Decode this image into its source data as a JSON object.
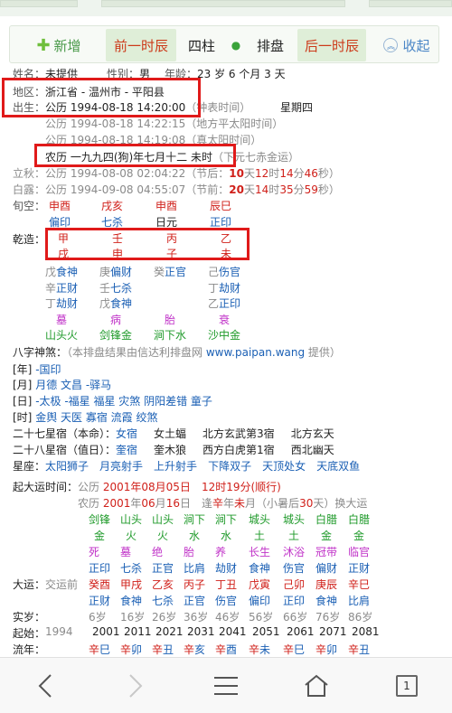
{
  "toolbar": {
    "add": "新增",
    "prev": "前一时辰",
    "sizhu": "四柱",
    "dot": "●",
    "pai": "排盘",
    "next": "后一时辰",
    "fold": "收起"
  },
  "profile": {
    "name_label": "姓名：",
    "name_value": "未提供",
    "gender_label": "性别：",
    "gender_value": "男",
    "age_label": "年龄：",
    "age_value": "23 岁 6 个月 3 天",
    "region_label": "地区：",
    "region_value": "浙江省 - 温州市 - 平阳县",
    "birth_label": "出生：",
    "birth_value": "公历 1994-08-18 14:20:00",
    "birth_note": "（钟表时间）",
    "weekday": "星期四",
    "solar_local": "公历 1994-08-18 14:22:15",
    "solar_local_note": "（地方平太阳时间）",
    "solar_true": "公历 1994-08-18 14:19:08",
    "solar_true_note": "（真太阳时间）",
    "lunar": "农历 一九九四(狗)年七月十二 未时",
    "lunar_note": "（下元七赤金运）"
  },
  "jieqi": {
    "liqiu_label": "立秋：",
    "liqiu_date": "公历 1994-08-08 02:04:22",
    "liqiu_jie": "（节后：",
    "liqiu_days": "10",
    "liqiu_days_unit": "天",
    "liqiu_hours": "12",
    "liqiu_hours_unit": "时",
    "liqiu_min": "14",
    "liqiu_min_unit": "分",
    "liqiu_sec": "46",
    "liqiu_sec_unit": "秒）",
    "bailu_label": "白露：",
    "bailu_date": "公历 1994-09-08 04:55:07",
    "bailu_jie": "（节前：",
    "bailu_days": "20",
    "bailu_days_unit": "天",
    "bailu_hours": "14",
    "bailu_hours_unit": "时",
    "bailu_min": "35",
    "bailu_min_unit": "分",
    "bailu_sec": "59",
    "bailu_sec_unit": "秒）"
  },
  "pillars": {
    "xunkong_label": "旬空：",
    "xunkong": [
      "申酉",
      "戌亥",
      "申酉",
      "辰巳"
    ],
    "shishen": [
      "偏印",
      "七杀",
      "日元",
      "正印"
    ],
    "qianzao_label": "乾造：",
    "gan": [
      "甲",
      "壬",
      "丙",
      "乙"
    ],
    "zhi": [
      "戌",
      "申",
      "子",
      "未"
    ],
    "canggan_row1": [
      [
        "戊",
        "食神"
      ],
      [
        "庚",
        "偏财"
      ],
      [
        "癸",
        "正官"
      ],
      [
        "己",
        "伤官"
      ]
    ],
    "canggan_row2": [
      [
        "辛",
        "正财"
      ],
      [
        "壬",
        "七杀"
      ],
      [
        "",
        ""
      ],
      [
        "丁",
        "劫财"
      ]
    ],
    "canggan_row3": [
      [
        "丁",
        "劫财"
      ],
      [
        "戊",
        "食神"
      ],
      [
        "",
        ""
      ],
      [
        "乙",
        "正印"
      ]
    ],
    "changsheng": [
      "墓",
      "病",
      "胎",
      "衰"
    ],
    "nayin": [
      "山头火",
      "剑锋金",
      "涧下水",
      "沙中金"
    ]
  },
  "shensha": {
    "title": "八字神煞：",
    "note_pre": "（本排盘结果由信达利排盘网 ",
    "site": "www.paipan.wang",
    "note_post": " 提供）",
    "year_tag": "[年]",
    "year_items": "-国印",
    "month_tag": "[月]",
    "month_items": "月德 文昌 -驿马",
    "day_tag": "[日]",
    "day_items": "-太极 -福星 福星 灾煞 阴阳差错 童子",
    "hour_tag": "[时]",
    "hour_items": "金舆 天医 寡宿 流霞 绞煞"
  },
  "stars": {
    "x27_label": "二十七星宿（本命）：",
    "x27_main": "女宿",
    "x27_rest": [
      "女土蝠",
      "北方玄武第3宿",
      "北方玄天"
    ],
    "x28_label": "二十八星宿（值日）：",
    "x28_main": "奎宿",
    "x28_rest": [
      "奎木狼",
      "西方白虎第1宿",
      "西北幽天"
    ],
    "xingzuo_label": "星座：",
    "xingzuo": [
      "太阳狮子",
      "月亮射手",
      "上升射手",
      "下降双子",
      "天顶处女",
      "天底双鱼"
    ]
  },
  "dayun": {
    "start_label": "起大运时间：",
    "start_pre": "公历 ",
    "start_date": "2001年08月05日",
    "start_time": "12时19分",
    "start_dir": "(顺行)",
    "lunar_pre": "农历 ",
    "lunar_date_a": "2001",
    "lunar_date_b": "年",
    "lunar_date_c": "06",
    "lunar_date_d": "月",
    "lunar_date_e": "16",
    "lunar_date_f": "日",
    "meet_pre": "逢",
    "meet_gan": "辛",
    "meet_mid": "年",
    "meet_zhi": "未",
    "meet_post": "月（小暑后",
    "meet_days": "30",
    "meet_end": "天）换大运",
    "nayin_row": [
      "剑锋",
      "山头",
      "山头",
      "涧下",
      "涧下",
      "城头",
      "城头",
      "白腊",
      "白腊"
    ],
    "wuxing_row": [
      "金",
      "火",
      "火",
      "水",
      "水",
      "土",
      "土",
      "金",
      "金"
    ],
    "changsheng_row": [
      "死",
      "墓",
      "绝",
      "胎",
      "养",
      "长生",
      "沐浴",
      "冠带",
      "临官"
    ],
    "gan_ss_row": [
      "正印",
      "七杀",
      "正官",
      "比肩",
      "劫财",
      "食神",
      "伤官",
      "偏财",
      "正财"
    ],
    "dayun_label": "大运：",
    "jiaoyun": "交运前",
    "dayun_gz": [
      [
        "癸",
        "酉"
      ],
      [
        "甲",
        "戌"
      ],
      [
        "乙",
        "亥"
      ],
      [
        "丙",
        "子"
      ],
      [
        "丁",
        "丑"
      ],
      [
        "戊",
        "寅"
      ],
      [
        "己",
        "卯"
      ],
      [
        "庚",
        "辰"
      ],
      [
        "辛",
        "巳"
      ]
    ],
    "zhi_ss_row": [
      "正财",
      "食神",
      "七杀",
      "正官",
      "伤官",
      "偏印",
      "正印",
      "食神",
      "比肩"
    ],
    "shisui_label": "实岁：",
    "shisui": [
      "6岁",
      "16岁",
      "26岁",
      "36岁",
      "46岁",
      "56岁",
      "66岁",
      "76岁",
      "86岁"
    ],
    "qishi_label": "起始：",
    "qishi": [
      "1994",
      "2001",
      "2011",
      "2021",
      "2031",
      "2041",
      "2051",
      "2061",
      "2071",
      "2081"
    ],
    "liunian_label": "流年：",
    "liunian": [
      [
        "辛",
        "巳"
      ],
      [
        "辛",
        "卯"
      ],
      [
        "辛",
        "丑"
      ],
      [
        "辛",
        "亥"
      ],
      [
        "辛",
        "酉"
      ],
      [
        "辛",
        "未"
      ],
      [
        "辛",
        "巳"
      ],
      [
        "辛",
        "卯"
      ],
      [
        "辛",
        "丑"
      ]
    ]
  },
  "nav": {
    "back": "back-arrow-icon",
    "forward": "forward-arrow-icon",
    "menu": "menu-icon",
    "home": "home-icon",
    "page": "1"
  }
}
